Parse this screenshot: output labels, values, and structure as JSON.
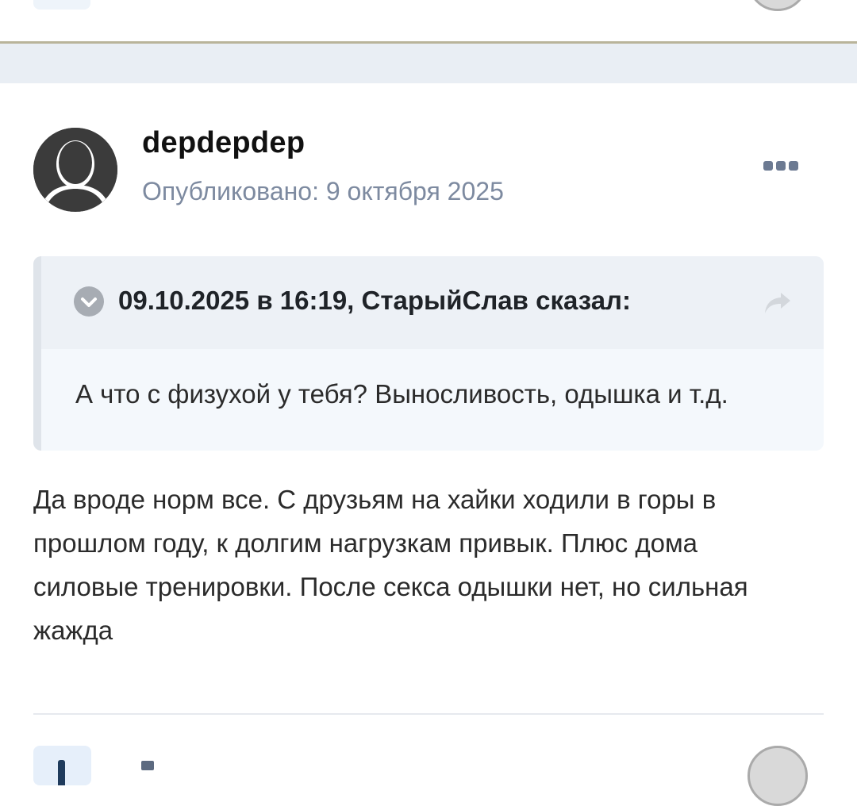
{
  "post": {
    "author": {
      "name": "depdepdep"
    },
    "published_label": "Опубликовано: 9 октября 2025",
    "quote": {
      "citation": "09.10.2025 в 16:19, СтарыйСлав сказал:",
      "text": "А что с физухой у тебя? Выносливость, одышка и т.д."
    },
    "content_lines": [
      "Да вроде норм все. С друзьям на хайки ходили в горы в",
      "прошлом году, к долгим нагрузкам привык. Плюс дома",
      "силовые тренировки. После секса одышки нет, но сильная",
      "жажда"
    ]
  },
  "icons": {
    "more": "more-options-icon",
    "quote_toggle": "chevron-down-icon",
    "quote_share": "share-arrow-icon",
    "avatar": "default-user-avatar"
  },
  "colors": {
    "accent_meta": "#7d8aa0",
    "divider": "#b9b49a",
    "quote_background": "#f4f8fc",
    "quote_header": "#edf1f6"
  }
}
